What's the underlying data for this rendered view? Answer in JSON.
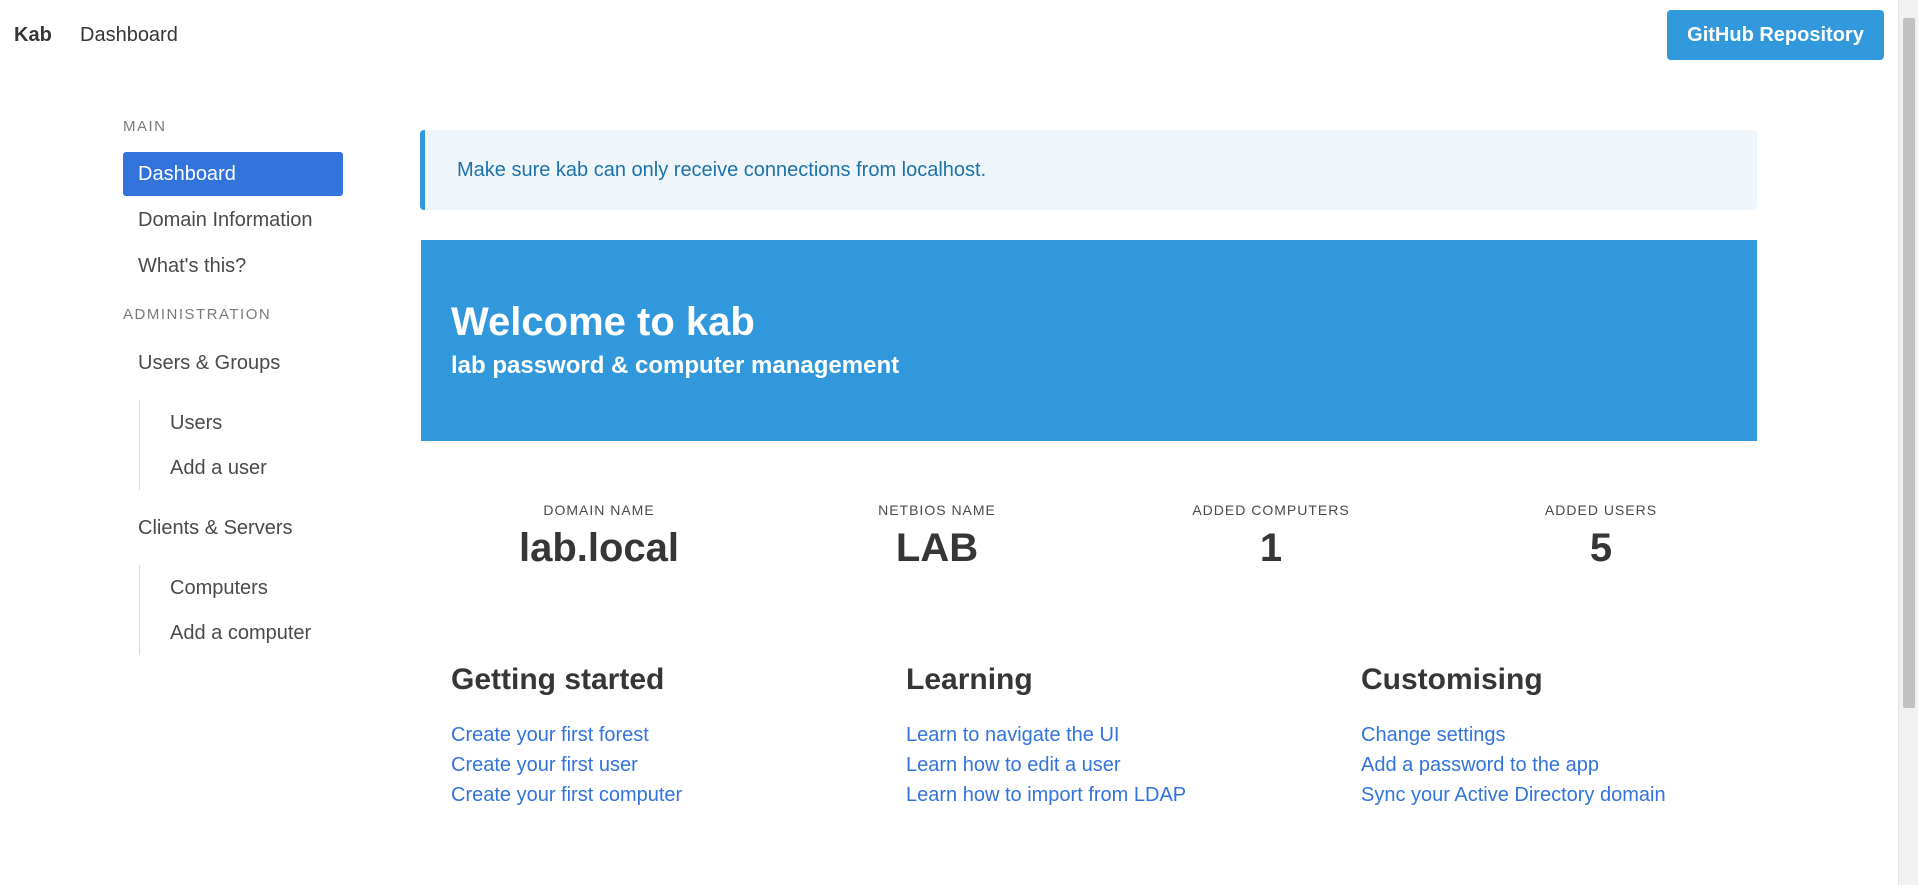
{
  "navbar": {
    "brand": "Kab",
    "nav_item": "Dashboard",
    "github_button": "GitHub Repository"
  },
  "sidebar": {
    "main_label": "Main",
    "main_items": [
      "Dashboard",
      "Domain Information",
      "What's this?"
    ],
    "admin_label": "Administration",
    "users_groups": "Users & Groups",
    "users_sub": [
      "Users",
      "Add a user"
    ],
    "clients_servers": "Clients & Servers",
    "clients_sub": [
      "Computers",
      "Add a computer"
    ]
  },
  "notification": "Make sure kab can only receive connections from localhost.",
  "hero": {
    "title": "Welcome to kab",
    "subtitle": "lab password & computer management"
  },
  "stats": [
    {
      "heading": "Domain Name",
      "value": "lab.local"
    },
    {
      "heading": "NetBIOS Name",
      "value": "LAB"
    },
    {
      "heading": "Added Computers",
      "value": "1"
    },
    {
      "heading": "Added Users",
      "value": "5"
    }
  ],
  "columns": [
    {
      "title": "Getting started",
      "links": [
        "Create your first forest",
        "Create your first user",
        "Create your first computer"
      ]
    },
    {
      "title": "Learning",
      "links": [
        "Learn to navigate the UI",
        "Learn how to edit a user",
        "Learn how to import from LDAP"
      ]
    },
    {
      "title": "Customising",
      "links": [
        "Change settings",
        "Add a password to the app",
        "Sync your Active Directory domain"
      ]
    }
  ],
  "colors": {
    "primary": "#3273dc",
    "info": "#3298dc",
    "notification_bg": "#eef6fc",
    "notification_text": "#1d72aa"
  }
}
